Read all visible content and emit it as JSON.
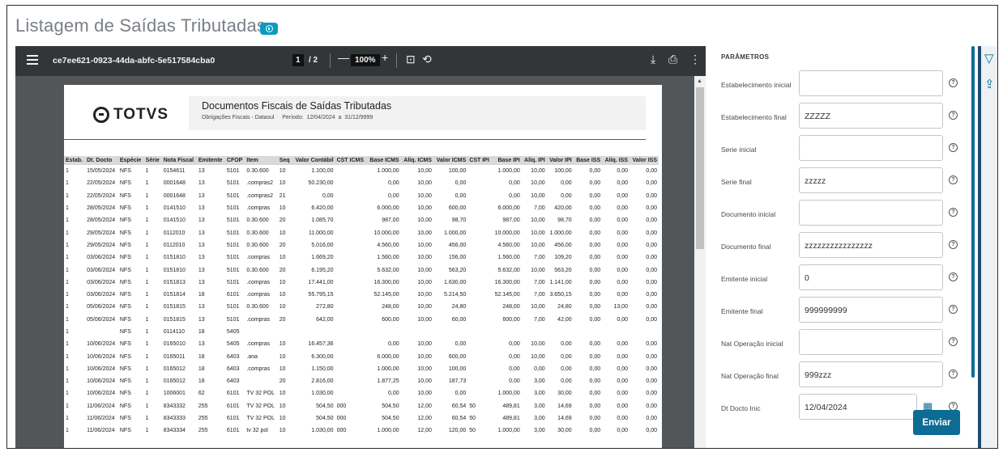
{
  "title": "Listagem de Saídas Tributadas",
  "viewer": {
    "doc_name": "ce7ee621-0923-44da-abfc-5e517584cba0",
    "page_current": "1",
    "page_total": "/ 2",
    "zoom": "100%"
  },
  "report": {
    "logo": "TOTVS",
    "heading": "Documentos Fiscais de Saídas Tributadas",
    "subheading": "Obrigações Fiscais - Datasul     Período:  12/04/2024  a  31/12/9999",
    "columns": [
      "Estab.",
      "Dt. Docto",
      "Espécie",
      "Série",
      "Nota Fiscal",
      "Emitente",
      "CFOP",
      "Item",
      "Seq",
      "Valor Contábil",
      "CST ICMS",
      "Base ICMS",
      "Alíq. ICMS",
      "Valor ICMS",
      "CST IPI",
      "Base IPI",
      "Alíq. IPI",
      "Valor IPI",
      "Base ISS",
      "Alíq. ISS",
      "Valor ISS"
    ],
    "rows": [
      [
        "1",
        "15/05/2024",
        "NFS",
        "1",
        "0154611",
        "13",
        "5101",
        "0.30.600",
        "10",
        "1.100,00",
        "",
        "1.000,00",
        "10,00",
        "100,00",
        "",
        "1.000,00",
        "10,00",
        "100,00",
        "0,00",
        "0,00",
        "0,00"
      ],
      [
        "1",
        "22/05/2024",
        "NFS",
        "1",
        "0001648",
        "13",
        "5101",
        ".compras2",
        "10",
        "50.230,00",
        "",
        "0,00",
        "10,00",
        "0,00",
        "",
        "0,00",
        "10,00",
        "0,00",
        "0,00",
        "0,00",
        "0,00"
      ],
      [
        "1",
        "22/05/2024",
        "NFS",
        "1",
        "0001648",
        "13",
        "5101",
        ".compras2",
        "21",
        "0,00",
        "",
        "0,00",
        "10,00",
        "0,00",
        "",
        "0,00",
        "10,00",
        "0,00",
        "0,00",
        "0,00",
        "0,00"
      ],
      [
        "1",
        "28/05/2024",
        "NFS",
        "1",
        "0141510",
        "13",
        "5101",
        ".compras",
        "10",
        "6.420,00",
        "",
        "6.000,00",
        "10,00",
        "600,00",
        "",
        "6.000,00",
        "7,00",
        "420,00",
        "0,00",
        "0,00",
        "0,00"
      ],
      [
        "1",
        "28/05/2024",
        "NFS",
        "1",
        "0141510",
        "13",
        "5101",
        "0.30.600",
        "20",
        "1.085,70",
        "",
        "987,00",
        "10,00",
        "98,70",
        "",
        "987,00",
        "10,00",
        "98,70",
        "0,00",
        "0,00",
        "0,00"
      ],
      [
        "1",
        "29/05/2024",
        "NFS",
        "1",
        "0112010",
        "13",
        "5101",
        "0.30.600",
        "10",
        "11.000,00",
        "",
        "10.000,00",
        "10,00",
        "1.000,00",
        "",
        "10.000,00",
        "10,00",
        "1.000,00",
        "0,00",
        "0,00",
        "0,00"
      ],
      [
        "1",
        "29/05/2024",
        "NFS",
        "1",
        "0112010",
        "13",
        "5101",
        "0.30.600",
        "20",
        "5.016,00",
        "",
        "4.560,00",
        "10,00",
        "456,00",
        "",
        "4.560,00",
        "10,00",
        "456,00",
        "0,00",
        "0,00",
        "0,00"
      ],
      [
        "1",
        "03/06/2024",
        "NFS",
        "1",
        "0151810",
        "13",
        "5101",
        ".compras",
        "10",
        "1.669,20",
        "",
        "1.560,00",
        "10,00",
        "156,00",
        "",
        "1.560,00",
        "7,00",
        "109,20",
        "0,00",
        "0,00",
        "0,00"
      ],
      [
        "1",
        "03/06/2024",
        "NFS",
        "1",
        "0151810",
        "13",
        "5101",
        "0.30.600",
        "20",
        "6.195,20",
        "",
        "5.632,00",
        "10,00",
        "563,20",
        "",
        "5.632,00",
        "10,00",
        "563,20",
        "0,00",
        "0,00",
        "0,00"
      ],
      [
        "1",
        "03/06/2024",
        "NFS",
        "1",
        "0151813",
        "13",
        "5101",
        ".compras",
        "10",
        "17.441,00",
        "",
        "16.300,00",
        "10,00",
        "1.630,00",
        "",
        "16.300,00",
        "7,00",
        "1.141,00",
        "0,00",
        "0,00",
        "0,00"
      ],
      [
        "1",
        "03/06/2024",
        "NFS",
        "1",
        "0151814",
        "18",
        "6101",
        ".compras",
        "10",
        "55.795,15",
        "",
        "52.145,00",
        "10,00",
        "5.214,50",
        "",
        "52.145,00",
        "7,00",
        "3.650,15",
        "0,00",
        "0,00",
        "0,00"
      ],
      [
        "1",
        "05/06/2024",
        "NFS",
        "1",
        "0151815",
        "13",
        "5101",
        "0.30.600",
        "10",
        "272,80",
        "",
        "248,00",
        "10,00",
        "24,80",
        "",
        "248,00",
        "10,00",
        "24,80",
        "0,00",
        "13,00",
        "0,00"
      ],
      [
        "1",
        "05/06/2024",
        "NFS",
        "1",
        "0151815",
        "13",
        "5101",
        ".compras",
        "20",
        "642,00",
        "",
        "600,00",
        "10,00",
        "60,00",
        "",
        "600,00",
        "7,00",
        "42,00",
        "0,00",
        "0,00",
        "0,00"
      ],
      [
        "1",
        "",
        "NFS",
        "1",
        "0114110",
        "18",
        "5405",
        "",
        "",
        "",
        "",
        "",
        "",
        "",
        "",
        "",
        "",
        "",
        "",
        "",
        ""
      ],
      [
        "1",
        "10/06/2024",
        "NFS",
        "1",
        "0165010",
        "13",
        "5405",
        ".compras",
        "10",
        "16.457,36",
        "",
        "0,00",
        "10,00",
        "0,00",
        "",
        "0,00",
        "10,00",
        "0,00",
        "0,00",
        "0,00",
        "0,00"
      ],
      [
        "1",
        "10/06/2024",
        "NFS",
        "1",
        "0165011",
        "18",
        "6403",
        ".ana",
        "10",
        "6.300,00",
        "",
        "6.000,00",
        "10,00",
        "600,00",
        "",
        "0,00",
        "10,00",
        "0,00",
        "0,00",
        "0,00",
        "0,00"
      ],
      [
        "1",
        "10/06/2024",
        "NFS",
        "1",
        "0165012",
        "18",
        "6403",
        ".compras",
        "10",
        "1.150,00",
        "",
        "1.000,00",
        "10,00",
        "100,00",
        "",
        "0,00",
        "0,00",
        "0,00",
        "0,00",
        "0,00",
        "0,00"
      ],
      [
        "1",
        "10/06/2024",
        "NFS",
        "1",
        "0165012",
        "18",
        "6403",
        "",
        "20",
        "2.816,00",
        "",
        "1.877,25",
        "10,00",
        "187,73",
        "",
        "0,00",
        "3,00",
        "0,00",
        "0,00",
        "0,00",
        "0,00"
      ],
      [
        "1",
        "10/06/2024",
        "NFS",
        "1",
        "1006001",
        "62",
        "6101",
        "TV 32 POL",
        "10",
        "1.030,00",
        "",
        "0,00",
        "10,00",
        "0,00",
        "",
        "1.000,00",
        "3,00",
        "30,00",
        "0,00",
        "0,00",
        "0,00"
      ],
      [
        "1",
        "11/06/2024",
        "NFS",
        "1",
        "8343332",
        "255",
        "6101",
        "TV 32 POL",
        "10",
        "504,50",
        "000",
        "504,50",
        "12,00",
        "60,54",
        "50",
        "489,81",
        "3,00",
        "14,69",
        "0,00",
        "0,00",
        "0,00"
      ],
      [
        "1",
        "11/06/2024",
        "NFS",
        "1",
        "8343333",
        "255",
        "6101",
        "TV 32 POL",
        "10",
        "504,50",
        "000",
        "504,50",
        "12,00",
        "60,54",
        "50",
        "489,81",
        "3,00",
        "14,69",
        "0,00",
        "0,00",
        "0,00"
      ],
      [
        "1",
        "11/06/2024",
        "NFS",
        "1",
        "8343334",
        "255",
        "6101",
        "tv 32 pol",
        "10",
        "1.030,00",
        "000",
        "1.000,00",
        "12,00",
        "120,00",
        "50",
        "1.000,00",
        "3,00",
        "30,00",
        "0,00",
        "0,00",
        "0,00"
      ]
    ]
  },
  "params": {
    "heading": "PARÂMETROS",
    "fields": [
      {
        "label": "Estabelecimento inicial",
        "value": ""
      },
      {
        "label": "Estabelecimento final",
        "value": "ZZZZZ"
      },
      {
        "label": "Serie inicial",
        "value": ""
      },
      {
        "label": "Serie final",
        "value": "zzzzz"
      },
      {
        "label": "Documento inicial",
        "value": ""
      },
      {
        "label": "Documento final",
        "value": "zzzzzzzzzzzzzzzz"
      },
      {
        "label": "Emitente inicial",
        "value": "0"
      },
      {
        "label": "Emitente final",
        "value": "999999999"
      },
      {
        "label": "Nat Operação inicial",
        "value": ""
      },
      {
        "label": "Nat Operação final",
        "value": "999zzz"
      },
      {
        "label": "Dt Docto Inic",
        "value": "12/04/2024"
      }
    ],
    "help_glyph": "?",
    "submit": "Enviar"
  }
}
